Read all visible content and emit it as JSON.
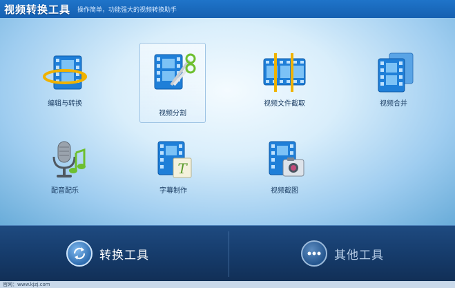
{
  "window": {
    "title": "视频转换工具",
    "subtitle": "操作简单，功能强大的视频转换助手"
  },
  "tools": [
    {
      "label": "编辑与转换",
      "icon": "film-convert-icon"
    },
    {
      "label": "视频分割",
      "icon": "film-scissors-icon",
      "selected": true
    },
    {
      "label": "视频文件截取",
      "icon": "film-clip-icon"
    },
    {
      "label": "视频合并",
      "icon": "film-merge-icon"
    },
    {
      "label": "配音配乐",
      "icon": "microphone-music-icon"
    },
    {
      "label": "字幕制作",
      "icon": "film-subtitle-icon"
    },
    {
      "label": "视频截图",
      "icon": "film-camera-icon"
    }
  ],
  "bottom_nav": {
    "convert_label": "转换工具",
    "convert_icon": "refresh-arrows-icon",
    "other_label": "其他工具",
    "other_icon": "more-dots-icon"
  },
  "status": {
    "text": "官网：www.kjzj.com"
  },
  "colors": {
    "titlebar": "#1560b1",
    "bottom_bar": "#163c6c",
    "film_blue": "#1f7fd8",
    "accent_green": "#6dbf2f"
  }
}
